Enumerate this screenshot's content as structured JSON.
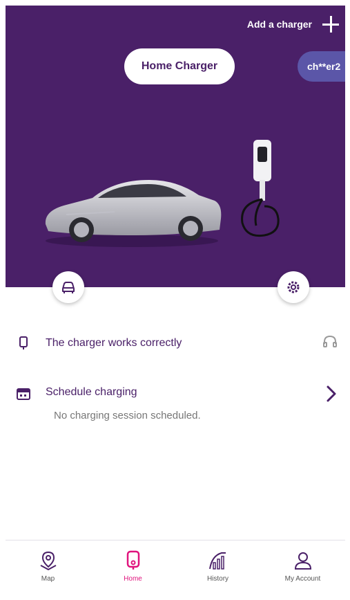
{
  "header": {
    "add_charger_label": "Add a charger"
  },
  "chargers": {
    "active": "Home Charger",
    "other": "ch**er2"
  },
  "status": {
    "text": "The charger works correctly"
  },
  "schedule": {
    "title": "Schedule charging",
    "subtitle": "No charging session scheduled."
  },
  "nav": {
    "items": [
      {
        "label": "Map",
        "icon": "map-pin-icon"
      },
      {
        "label": "Home",
        "icon": "charger-icon",
        "active": true
      },
      {
        "label": "History",
        "icon": "chart-icon"
      },
      {
        "label": "My Account",
        "icon": "user-icon"
      }
    ]
  },
  "colors": {
    "primary": "#4a2068",
    "accent": "#e0137d",
    "chip_other": "#5b56a8"
  }
}
